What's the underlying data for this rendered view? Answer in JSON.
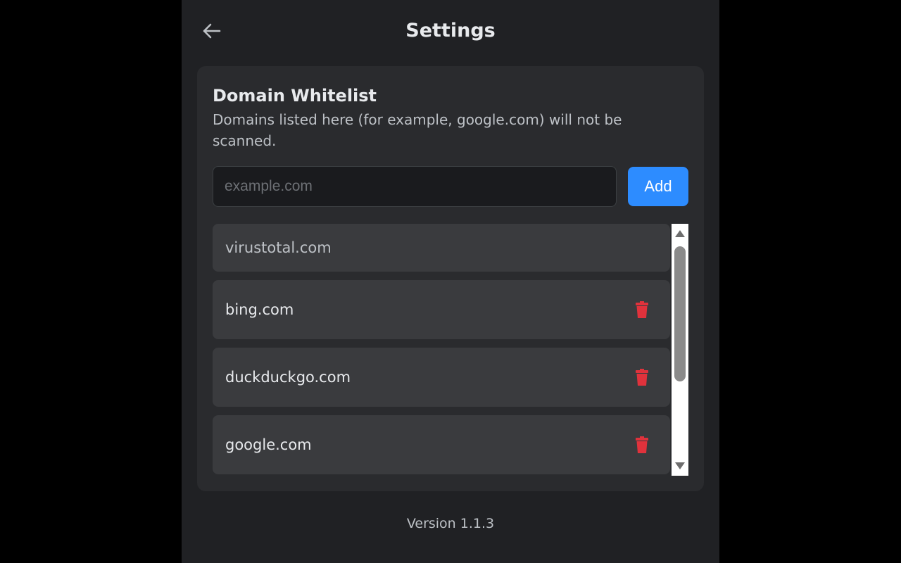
{
  "header": {
    "title": "Settings",
    "back_icon": "arrow-left-icon"
  },
  "whitelist": {
    "title": "Domain Whitelist",
    "description": "Domains listed here (for example, google.com) will not be scanned.",
    "input": {
      "value": "",
      "placeholder": "example.com"
    },
    "add_label": "Add",
    "items": [
      {
        "label": "virustotal.com",
        "removable": false
      },
      {
        "label": "bing.com",
        "removable": true
      },
      {
        "label": "duckduckgo.com",
        "removable": true
      },
      {
        "label": "google.com",
        "removable": true
      }
    ],
    "delete_icon": "trash-icon"
  },
  "footer": {
    "version": "Version 1.1.3"
  },
  "colors": {
    "background": "#202124",
    "card": "#2a2b2e",
    "item": "#3a3b3e",
    "accent": "#2d8cff",
    "danger": "#e0323c"
  }
}
